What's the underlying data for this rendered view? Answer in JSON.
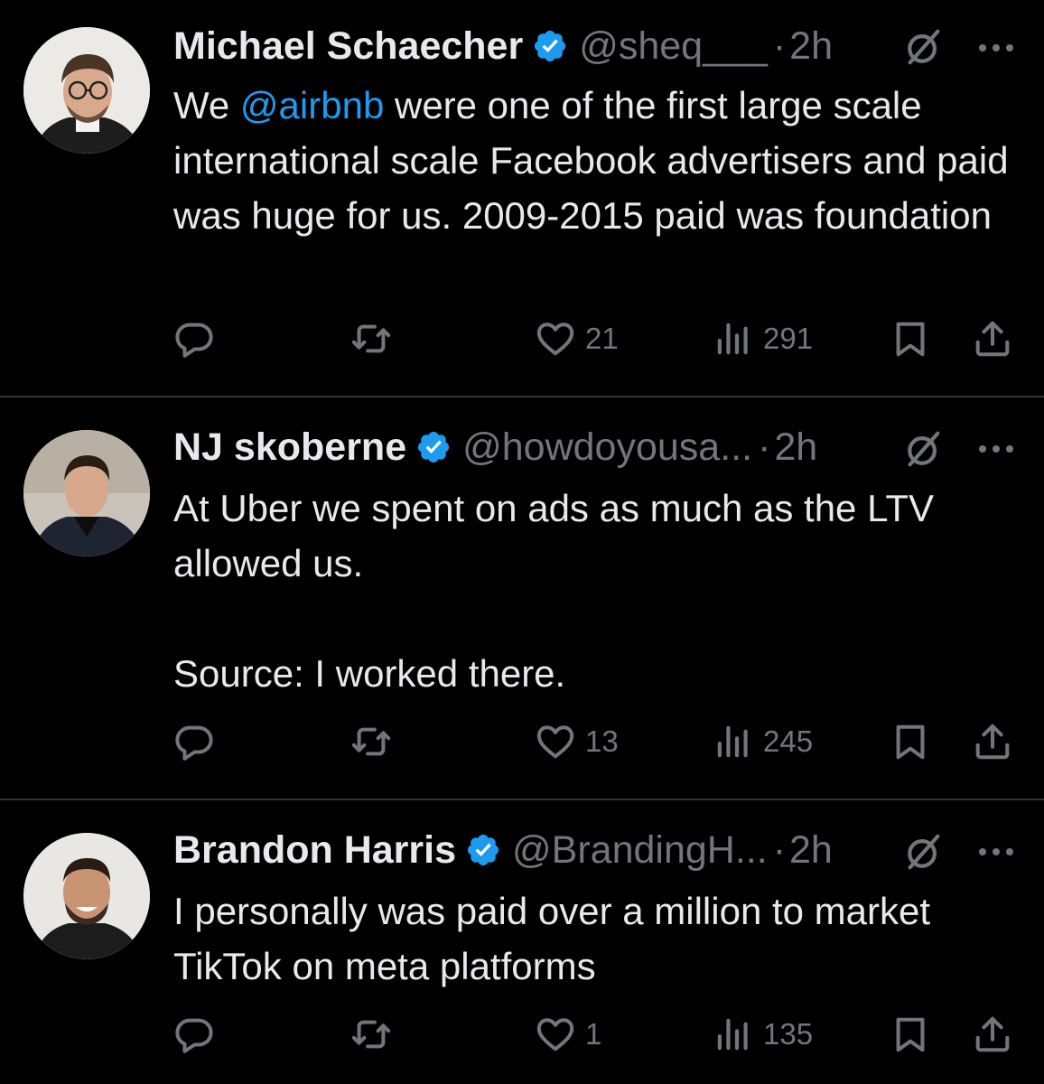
{
  "tweets": [
    {
      "name": "Michael Schaecher",
      "handle": "@sheq___",
      "separator": "·",
      "time": "2h",
      "mention": "@airbnb",
      "text_prefix": "We ",
      "text_after_mention": " were one of the first large scale international scale Facebook advertisers and paid was huge for us. 2009-2015 paid was foundation",
      "likes": "21",
      "views": "291"
    },
    {
      "name": "NJ skoberne",
      "handle": "@howdoyousa...",
      "separator": "·",
      "time": "2h",
      "text": "At Uber we spent on ads as much as the LTV allowed us.\n\nSource: I worked there.",
      "likes": "13",
      "views": "245"
    },
    {
      "name": "Brandon Harris",
      "handle": "@BrandingH...",
      "separator": "·",
      "time": "2h",
      "text": "I personally was paid over a million to market TikTok on meta platforms",
      "likes": "1",
      "views": "135"
    }
  ],
  "colors": {
    "background": "#000000",
    "text": "#e7e9ea",
    "secondary": "#71767b",
    "accent": "#1d9bf0",
    "divider": "#2f3336"
  },
  "icons": [
    "verified-badge-icon",
    "grok-icon",
    "more-icon",
    "reply-icon",
    "retweet-icon",
    "like-icon",
    "views-icon",
    "bookmark-icon",
    "share-icon"
  ]
}
